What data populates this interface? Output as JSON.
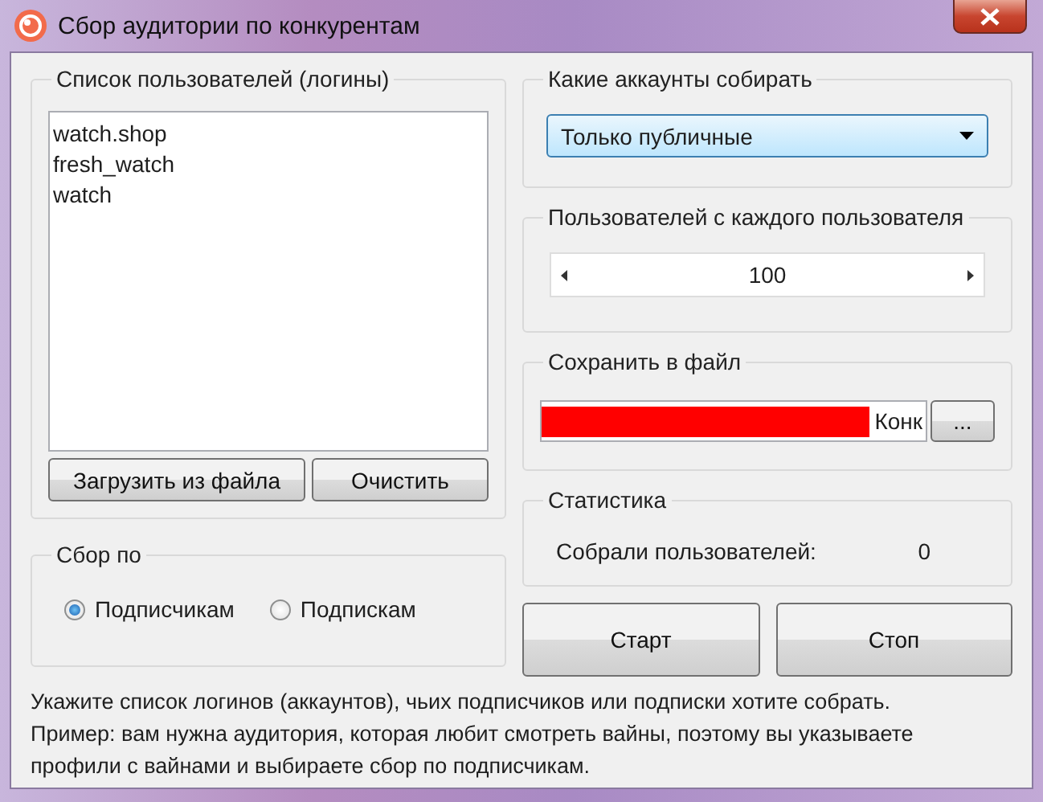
{
  "window": {
    "title": "Сбор аудитории по конкурентам"
  },
  "users_group": {
    "title": "Список пользователей (логины)",
    "items": [
      {
        "label": "watch.shop",
        "selected": false
      },
      {
        "label": "fresh_watch",
        "selected": false
      },
      {
        "label": "watch",
        "selected": false
      }
    ],
    "buttons": [
      "Загрузить из файла",
      "Очистить"
    ]
  },
  "collect_by": {
    "title": "Сбор по",
    "options": [
      {
        "label": "Подписчикам",
        "selected": true
      },
      {
        "label": "Подпискам",
        "selected": false
      }
    ]
  },
  "accounts_group": {
    "title": "Какие аккаунты собирать",
    "dropdown": {
      "value": "Только публичные"
    }
  },
  "per_user_group": {
    "title": "Пользователей с каждого пользователя",
    "spinner": {
      "value": "100"
    }
  },
  "save_group": {
    "title": "Сохранить в файл",
    "field": {
      "value": "Конк"
    },
    "browse_button": "..."
  },
  "stats_group": {
    "title": "Статистика",
    "label": "Собрали пользователей:",
    "value": "0"
  },
  "actions": [
    "Старт",
    "Стоп"
  ],
  "help_lines": [
    "Укажите список логинов (аккаунтов), чьих подписчиков или подписки хотите собрать.",
    "Пример: вам нужна аудитория, которая любит смотреть вайны, поэтому вы указываете",
    "профили с вайнами и выбираете сбор по подписчикам."
  ]
}
